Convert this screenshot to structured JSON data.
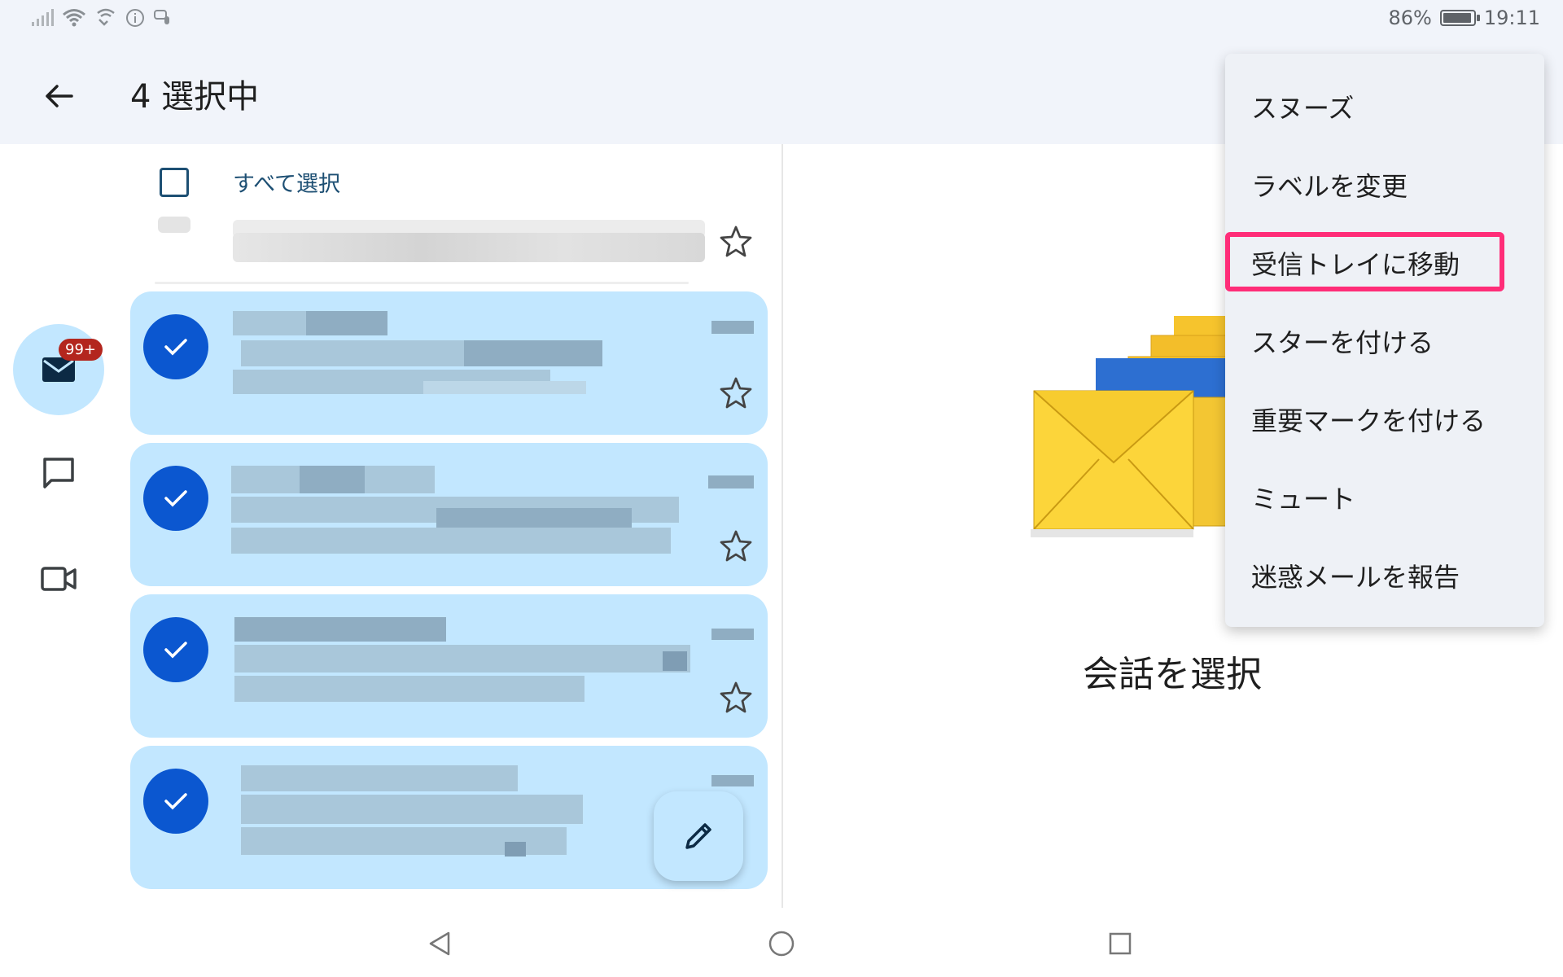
{
  "status_bar": {
    "battery_text": "86%",
    "battery_level": 0.86,
    "time": "19:11",
    "icons": [
      "signal-icon",
      "wifi-icon",
      "wifi-calling-icon",
      "info-icon",
      "voice-icon"
    ]
  },
  "app_bar": {
    "title": "4 選択中",
    "back_icon": "arrow-back-icon"
  },
  "rail": {
    "mail_badge": "99+",
    "items": [
      "mail-icon",
      "chat-icon",
      "video-icon"
    ]
  },
  "list": {
    "select_all_label": "すべて選択",
    "selected_count": 4,
    "selected_color": "#c2e7ff",
    "check_color": "#0b57d0"
  },
  "detail": {
    "empty_label": "会話を選択"
  },
  "menu": {
    "items": [
      "スヌーズ",
      "ラベルを変更",
      "受信トレイに移動",
      "スターを付ける",
      "重要マークを付ける",
      "ミュート",
      "迷惑メールを報告"
    ],
    "highlighted_index": 2,
    "highlight_color": "#ff2d78"
  },
  "nav_bar": {
    "buttons": [
      "back-triangle-icon",
      "home-circle-icon",
      "recents-square-icon"
    ]
  }
}
